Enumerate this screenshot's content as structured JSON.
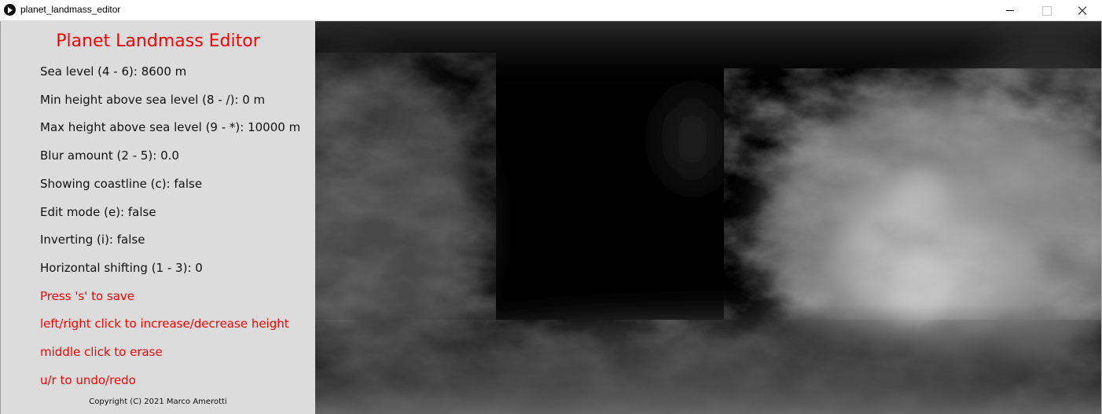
{
  "window": {
    "title": "planet_landmass_editor",
    "icon": "play-circle-icon",
    "controls": [
      "minimize-icon",
      "maximize-icon",
      "close-icon"
    ]
  },
  "panel": {
    "title": "Planet Landmass Editor",
    "settings": [
      "Sea level (4 - 6): 8600 m",
      "Min height above sea level (8 - /): 0 m",
      "Max height above sea level (9 - *): 10000 m",
      "Blur amount (2 - 5): 0.0",
      "Showing coastline (c): false",
      "Edit mode (e): false",
      "Inverting (i): false",
      "Horizontal shifting (1 - 3): 0"
    ],
    "help": [
      "Press 's' to save",
      "left/right click to increase/decrease height",
      "middle click to erase",
      "u/r to undo/redo"
    ],
    "copyright": "Copyright (C) 2021  Marco Amerotti"
  },
  "colors": {
    "panel_background": "#dcdcdc",
    "accent": "#ff0000",
    "text": "#111111",
    "map_background": "#000000"
  }
}
